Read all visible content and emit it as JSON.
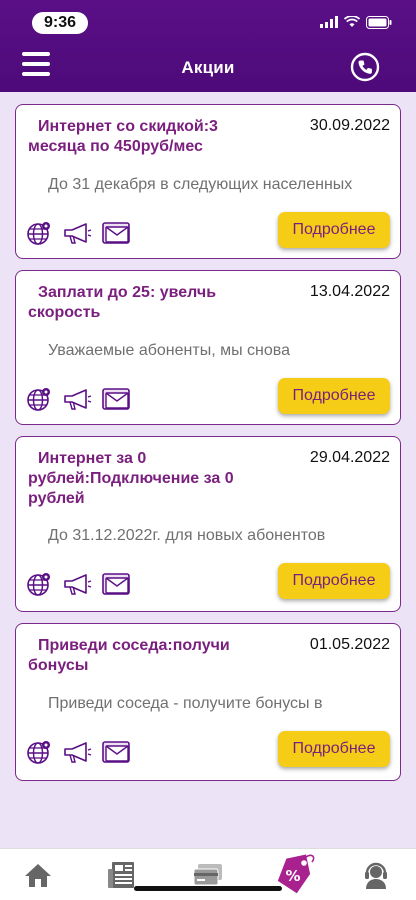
{
  "status_bar": {
    "time": "9:36"
  },
  "header": {
    "title": "Акции"
  },
  "promotions": [
    {
      "title": "Интернет со скидкой:3 месяца по 450руб/мес",
      "date": "30.09.2022",
      "description": "До 31 декабря в следующих населенных",
      "button": "Подробнее"
    },
    {
      "title": "Заплати до 25: увелчь скорость",
      "date": "13.04.2022",
      "description": "Уважаемые абоненты, мы снова",
      "button": "Подробнее"
    },
    {
      "title": "Интернет за 0 рублей:Подключение за 0 рублей",
      "date": "29.04.2022",
      "description": "До 31.12.2022г. для новых абонентов",
      "button": "Подробнее"
    },
    {
      "title": "Приведи соседа:получи бонусы",
      "date": "01.05.2022",
      "description": "Приведи соседа - получите бонусы в",
      "button": "Подробнее"
    }
  ],
  "tabbar": {
    "items": [
      {
        "icon": "home-icon",
        "active": false
      },
      {
        "icon": "news-icon",
        "active": false
      },
      {
        "icon": "payment-card-icon",
        "active": false
      },
      {
        "icon": "promo-tag-icon",
        "active": true
      },
      {
        "icon": "support-icon",
        "active": false
      }
    ]
  },
  "colors": {
    "header": "#4d0a79",
    "accent": "#7a1f7e",
    "button": "#f5cc16",
    "background": "#ece3f7"
  }
}
